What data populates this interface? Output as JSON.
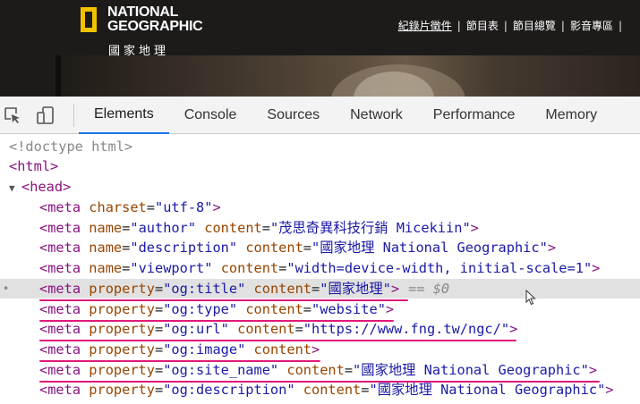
{
  "site": {
    "logo_line1": "NATIONAL",
    "logo_line2": "GEOGRAPHIC",
    "logo_sub": "國家地理",
    "nav": [
      "紀錄片徵件",
      "節目表",
      "節目總覽",
      "影音專區"
    ],
    "nav_sep": "|"
  },
  "devtools": {
    "tabs": [
      "Elements",
      "Console",
      "Sources",
      "Network",
      "Performance",
      "Memory"
    ],
    "active_tab": "Elements",
    "icons": [
      "inspect-element-icon",
      "device-toolbar-icon"
    ],
    "accent_color": "#1a73e8",
    "underline_color": "#e0197a",
    "dom": {
      "doctype": "<!doctype html>",
      "html_open": "<html>",
      "head_open": "<head>",
      "selected_suffix": "== $0",
      "lines": [
        {
          "tag": "meta",
          "a1": "charset",
          "v1": "utf-8"
        },
        {
          "tag": "meta",
          "a1": "name",
          "v1": "author",
          "a2": "content",
          "v2": "茂思奇異科技行銷 Micekiin"
        },
        {
          "tag": "meta",
          "a1": "name",
          "v1": "description",
          "a2": "content",
          "v2": "國家地理 National Geographic"
        },
        {
          "tag": "meta",
          "a1": "name",
          "v1": "viewport",
          "a2": "content",
          "v2": "width=device-width, initial-scale=1"
        },
        {
          "tag": "meta",
          "a1": "property",
          "v1": "og:title",
          "a2": "content",
          "v2": "國家地理"
        },
        {
          "tag": "meta",
          "a1": "property",
          "v1": "og:type",
          "a2": "content",
          "v2": "website"
        },
        {
          "tag": "meta",
          "a1": "property",
          "v1": "og:url",
          "a2": "content",
          "v2": "https://www.fng.tw/ngc/"
        },
        {
          "tag": "meta",
          "a1": "property",
          "v1": "og:image",
          "a2": "content"
        },
        {
          "tag": "meta",
          "a1": "property",
          "v1": "og:site_name",
          "a2": "content",
          "v2": "國家地理 National Geographic"
        },
        {
          "tag": "meta",
          "a1": "property",
          "v1": "og:description",
          "a2": "content",
          "v2": "國家地理 National Geographic"
        }
      ]
    }
  }
}
